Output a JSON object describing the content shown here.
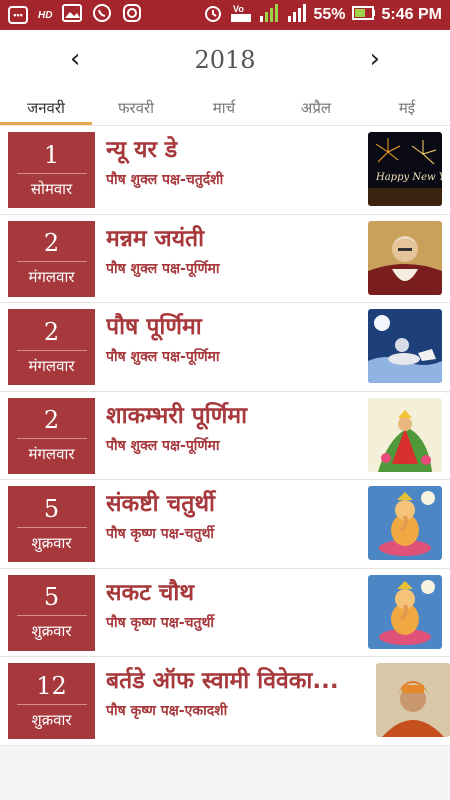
{
  "status_bar": {
    "left_icons": [
      "message-icon",
      "hd-icon",
      "gallery-icon",
      "whatsapp-icon",
      "instagram-icon"
    ],
    "hd_text": "HD",
    "battery": "55%",
    "time": "5:46 PM"
  },
  "year_nav": {
    "prev": "‹",
    "year": "2018",
    "next": "›"
  },
  "tabs": [
    {
      "label": "जनवरी"
    },
    {
      "label": "फरवरी"
    },
    {
      "label": "मार्च"
    },
    {
      "label": "अप्रैल"
    },
    {
      "label": "मई"
    }
  ],
  "colors": {
    "accent": "#a7393d",
    "status_bar": "#a5252d",
    "tab_underline": "#e8a64a"
  },
  "events": [
    {
      "date": "1",
      "day": "सोमवार",
      "title": "न्यू यर डे",
      "subtitle": "पौष शुक्ल पक्ष-चतुर्दशी",
      "image": "fireworks-thumbnail"
    },
    {
      "date": "2",
      "day": "मंगलवार",
      "title": "मन्नम जयंती",
      "subtitle": "पौष शुक्ल पक्ष-पूर्णिमा",
      "image": "portrait-thumbnail"
    },
    {
      "date": "2",
      "day": "मंगलवार",
      "title": "पौष पूर्णिमा",
      "subtitle": "पौष शुक्ल पक्ष-पूर्णिमा",
      "image": "moon-chariot-thumbnail"
    },
    {
      "date": "2",
      "day": "मंगलवार",
      "title": "शाकम्भरी पूर्णिमा",
      "subtitle": "पौष शुक्ल पक्ष-पूर्णिमा",
      "image": "goddess-thumbnail"
    },
    {
      "date": "5",
      "day": "शुक्रवार",
      "title": "संकष्टी चतुर्थी",
      "subtitle": "पौष कृष्ण पक्ष-चतुर्थी",
      "image": "ganesha-thumbnail"
    },
    {
      "date": "5",
      "day": "शुक्रवार",
      "title": "सकट चौथ",
      "subtitle": "पौष कृष्ण पक्ष-चतुर्थी",
      "image": "ganesha-thumbnail"
    },
    {
      "date": "12",
      "day": "शुक्रवार",
      "title": "बर्तडे ऑफ स्वामी विवेका...",
      "subtitle": "पौष कृष्ण पक्ष-एकादशी",
      "image": "vivekananda-thumbnail"
    }
  ]
}
